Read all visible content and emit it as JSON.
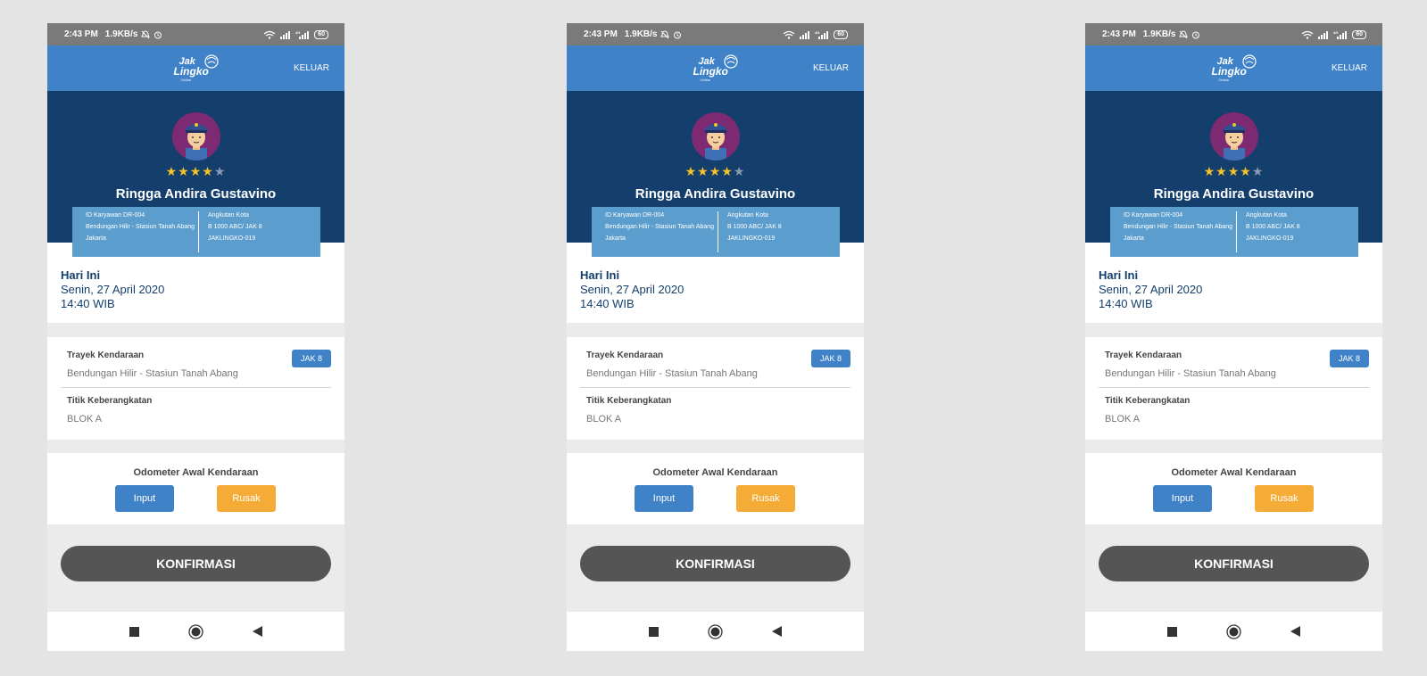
{
  "colors": {
    "background": "#e4e4e4",
    "status_bar": "#7a7a7a",
    "header": "#3f82c8",
    "profile_bg": "#143e6c",
    "info_card": "#5b9dcc",
    "star_filled": "#f6c22a",
    "input_button": "#3f82c8",
    "rusak_button": "#f5ac37",
    "confirm_button": "#555555"
  },
  "screens": [
    {
      "status_bar": {
        "time": "2:43 PM",
        "speed": "1.9KB/s",
        "battery": "60",
        "icons": [
          "mute-icon",
          "alarm-icon",
          "wifi-icon",
          "signal-icon",
          "signal-4g-icon",
          "battery-icon"
        ]
      },
      "header": {
        "logo_top": "Jak",
        "logo_bottom": "Lingko",
        "logo_sub": "Online",
        "logout": "KELUAR"
      },
      "profile": {
        "rating": 4,
        "rating_max": 5,
        "name": "Ringga Andira Gustavino",
        "employee_id": "ID Karyawan DR-004",
        "route": "Bendungan Hilir - Stasiun Tanah Abang",
        "city": "Jakarta",
        "vehicle_type": "Angkutan Kota",
        "plate": "B 1000 ABC/ JAK 8",
        "vehicle_code": "JAKLINGKO-019"
      },
      "today": {
        "title": "Hari Ini",
        "date": "Senin, 27 April 2020",
        "time": "14:40 WIB"
      },
      "route_card": {
        "trayek_label": "Trayek Kendaraan",
        "trayek_value": "Bendungan Hilir - Stasiun Tanah Abang",
        "badge": "JAK 8",
        "departure_label": "Titik Keberangkatan",
        "departure_value": "BLOK A"
      },
      "odometer": {
        "title": "Odometer Awal Kendaraan",
        "input_label": "Input",
        "broken_label": "Rusak"
      },
      "confirm_label": "KONFIRMASI",
      "nav": [
        "square-icon",
        "home-circle-icon",
        "back-triangle-icon"
      ]
    },
    {
      "status_bar": {
        "time": "2:43 PM",
        "speed": "1.9KB/s",
        "battery": "60",
        "icons": [
          "mute-icon",
          "alarm-icon",
          "wifi-icon",
          "signal-icon",
          "signal-4g-icon",
          "battery-icon"
        ]
      },
      "header": {
        "logo_top": "Jak",
        "logo_bottom": "Lingko",
        "logo_sub": "Online",
        "logout": "KELUAR"
      },
      "profile": {
        "rating": 4,
        "rating_max": 5,
        "name": "Ringga Andira Gustavino",
        "employee_id": "ID Karyawan DR-004",
        "route": "Bendungan Hilir - Stasiun Tanah Abang",
        "city": "Jakarta",
        "vehicle_type": "Angkutan Kota",
        "plate": "B 1000 ABC/ JAK 8",
        "vehicle_code": "JAKLINGKO-019"
      },
      "today": {
        "title": "Hari Ini",
        "date": "Senin, 27 April 2020",
        "time": "14:40 WIB"
      },
      "route_card": {
        "trayek_label": "Trayek Kendaraan",
        "trayek_value": "Bendungan Hilir - Stasiun Tanah Abang",
        "badge": "JAK 8",
        "departure_label": "Titik Keberangkatan",
        "departure_value": "BLOK A"
      },
      "odometer": {
        "title": "Odometer Awal Kendaraan",
        "input_label": "Input",
        "broken_label": "Rusak"
      },
      "confirm_label": "KONFIRMASI",
      "nav": [
        "square-icon",
        "home-circle-icon",
        "back-triangle-icon"
      ]
    },
    {
      "status_bar": {
        "time": "2:43 PM",
        "speed": "1.9KB/s",
        "battery": "60",
        "icons": [
          "mute-icon",
          "alarm-icon",
          "wifi-icon",
          "signal-icon",
          "signal-4g-icon",
          "battery-icon"
        ]
      },
      "header": {
        "logo_top": "Jak",
        "logo_bottom": "Lingko",
        "logo_sub": "Online",
        "logout": "KELUAR"
      },
      "profile": {
        "rating": 4,
        "rating_max": 5,
        "name": "Ringga Andira Gustavino",
        "employee_id": "ID Karyawan DR-004",
        "route": "Bendungan Hilir - Stasiun Tanah Abang",
        "city": "Jakarta",
        "vehicle_type": "Angkutan Kota",
        "plate": "B 1000 ABC/ JAK 8",
        "vehicle_code": "JAKLINGKO-019"
      },
      "today": {
        "title": "Hari Ini",
        "date": "Senin, 27 April 2020",
        "time": "14:40 WIB"
      },
      "route_card": {
        "trayek_label": "Trayek Kendaraan",
        "trayek_value": "Bendungan Hilir - Stasiun Tanah Abang",
        "badge": "JAK 8",
        "departure_label": "Titik Keberangkatan",
        "departure_value": "BLOK A"
      },
      "odometer": {
        "title": "Odometer Awal Kendaraan",
        "input_label": "Input",
        "broken_label": "Rusak"
      },
      "confirm_label": "KONFIRMASI",
      "nav": [
        "square-icon",
        "home-circle-icon",
        "back-triangle-icon"
      ]
    }
  ]
}
